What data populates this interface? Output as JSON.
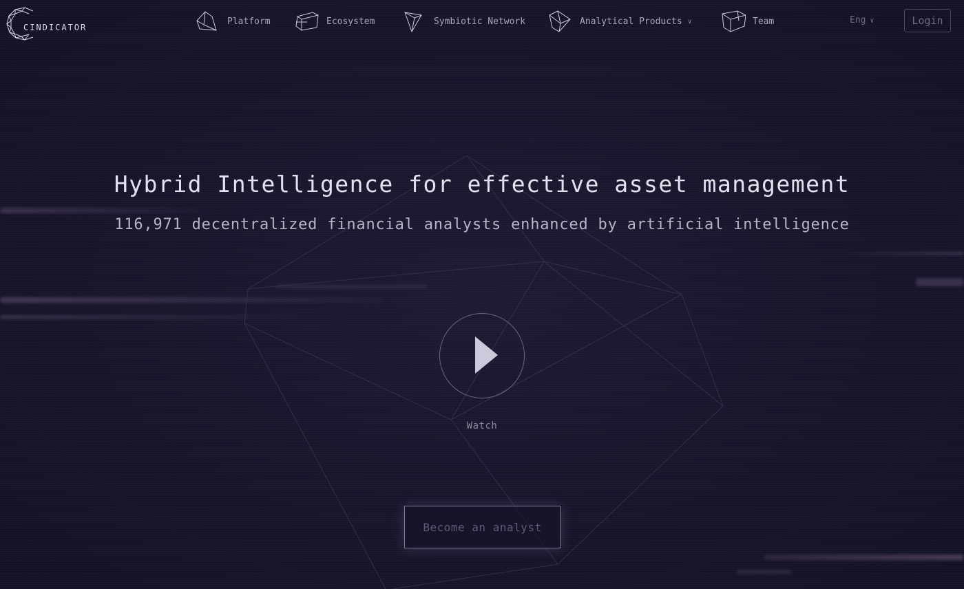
{
  "brand": {
    "name": "CINDICATOR"
  },
  "nav": {
    "items": [
      {
        "label": "Platform",
        "icon": "pentagon-wire-icon"
      },
      {
        "label": "Ecosystem",
        "icon": "prism-wire-icon"
      },
      {
        "label": "Symbiotic Network",
        "icon": "triangle-wire-icon"
      },
      {
        "label": "Analytical Products",
        "icon": "crystal-wire-icon",
        "has_dropdown": true
      },
      {
        "label": "Team",
        "icon": "cube-wire-icon"
      }
    ],
    "language": "Eng",
    "login_label": "Login"
  },
  "hero": {
    "title": "Hybrid Intelligence for effective asset management",
    "subtitle": "116,971 decentralized financial analysts enhanced by artificial intelligence",
    "watch_label": "Watch",
    "cta_label": "Become an analyst"
  },
  "colors": {
    "background": "#141328",
    "text_primary": "#e4e1ee",
    "text_secondary": "#b8b4c8",
    "accent_streak": "#a98cbf"
  }
}
